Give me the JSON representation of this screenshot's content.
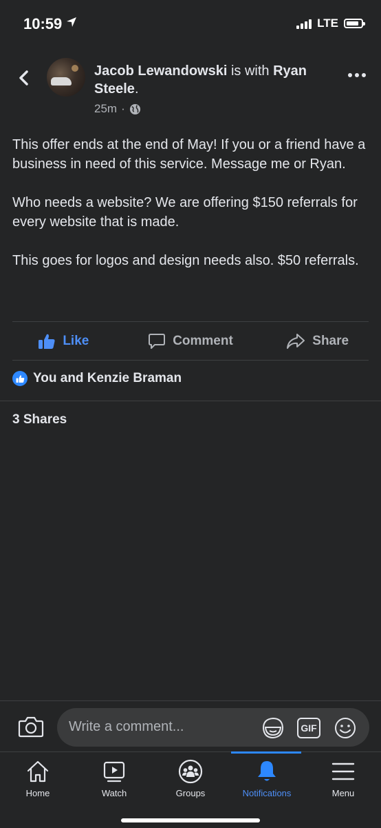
{
  "status_bar": {
    "time": "10:59",
    "network": "LTE"
  },
  "post": {
    "author": "Jacob Lewandowski",
    "connector": " is with ",
    "tagged": "Ryan Steele",
    "period": ".",
    "time_ago": "25m",
    "separator": "·",
    "paragraphs": [
      "This offer ends at the end of May! If you or a friend have a business in need of this service. Message me or Ryan.",
      "Who needs a website? We are offering $150 referrals for every website that is made.",
      "This goes for logos and design needs also. $50 referrals."
    ],
    "actions": {
      "like": "Like",
      "comment": "Comment",
      "share": "Share"
    },
    "reactions_text": "You and Kenzie Braman",
    "shares_text": "3 Shares"
  },
  "comment_bar": {
    "placeholder": "Write a comment...",
    "gif_label": "GIF"
  },
  "tabs": [
    {
      "label": "Home"
    },
    {
      "label": "Watch"
    },
    {
      "label": "Groups"
    },
    {
      "label": "Notifications"
    },
    {
      "label": "Menu"
    }
  ],
  "colors": {
    "background": "#242526",
    "accent": "#2d88ff",
    "like_text": "#4e8ff7",
    "text": "#e4e6eb",
    "muted": "#b0b3b8"
  }
}
